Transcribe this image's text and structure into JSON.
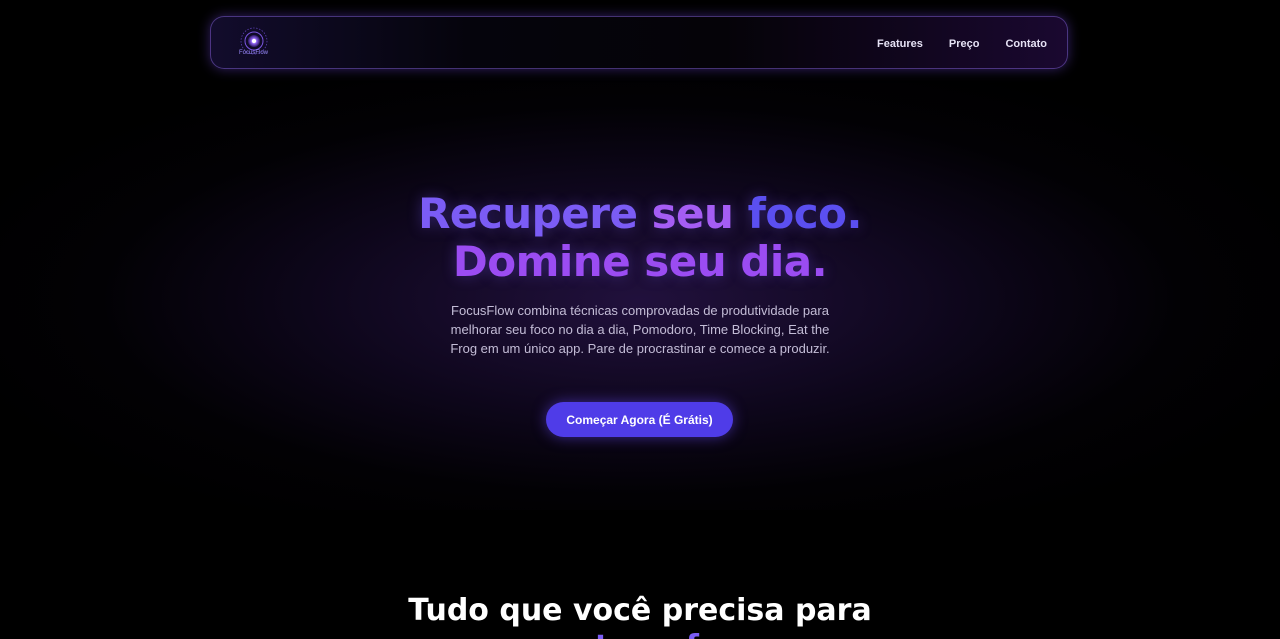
{
  "colors": {
    "background": "#000000",
    "accent_purple": "#7b5cf5",
    "accent_violet": "#a55df4",
    "cta_bg": "#4f3ce8",
    "nav_border": "#785ac8"
  },
  "navbar": {
    "logo_icon": "focusflow-logo-icon",
    "logo_text": "FocusFlow",
    "links": [
      {
        "label": "Features"
      },
      {
        "label": "Preço"
      },
      {
        "label": "Contato"
      }
    ]
  },
  "hero": {
    "title_line1_part1": "Recupere",
    "title_line1_part2": "seu",
    "title_line1_part3": "foco.",
    "title_line2": "Domine seu dia.",
    "subtitle": "FocusFlow combina técnicas comprovadas de produtividade para melhorar seu foco no dia a dia, Pomodoro, Time Blocking, Eat the Frog em um único app. Pare de procrastinar e comece a produzir.",
    "cta_label": "Começar Agora (É Grátis)"
  },
  "features_section": {
    "title_line1": "Tudo que você precisa para",
    "title_line2": "manter o foco"
  }
}
